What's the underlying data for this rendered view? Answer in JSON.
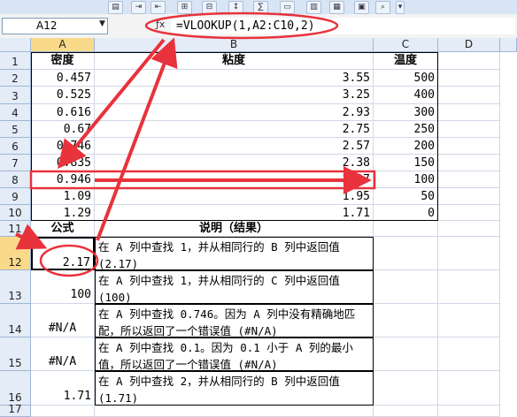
{
  "toolbar_icons": [
    "ruler-icon",
    "indent-icon",
    "outdent-icon",
    "group-icon",
    "ungroup-icon",
    "sort-icon",
    "function-icon",
    "folder-icon",
    "chart-icon",
    "chart-icon",
    "calculator-icon",
    "search-icon",
    "dropdown-icon"
  ],
  "name_box": "A12",
  "formula": "=VLOOKUP(1,A2:C10,2)",
  "columns": [
    "A",
    "B",
    "C",
    "D"
  ],
  "rows": [
    "1",
    "2",
    "3",
    "4",
    "5",
    "6",
    "7",
    "8",
    "9",
    "10",
    "11",
    "12",
    "13",
    "14",
    "15",
    "16",
    "17"
  ],
  "headers": {
    "a": "密度",
    "b": "粘度",
    "c": "温度"
  },
  "data": [
    {
      "a": "0.457",
      "b": "3.55",
      "c": "500"
    },
    {
      "a": "0.525",
      "b": "3.25",
      "c": "400"
    },
    {
      "a": "0.616",
      "b": "2.93",
      "c": "300"
    },
    {
      "a": "0.67",
      "b": "2.75",
      "c": "250"
    },
    {
      "a": "0.746",
      "b": "2.57",
      "c": "200"
    },
    {
      "a": "0.835",
      "b": "2.38",
      "c": "150"
    },
    {
      "a": "0.946",
      "b": "2.17",
      "c": "100"
    },
    {
      "a": "1.09",
      "b": "1.95",
      "c": "50"
    },
    {
      "a": "1.29",
      "b": "1.71",
      "c": "0"
    }
  ],
  "formula_header": "公式",
  "desc_header": "说明（结果）",
  "results": [
    {
      "value": "2.17",
      "desc": "在 A 列中查找 1，并从相同行的 B 列中返回值 (2.17)"
    },
    {
      "value": "100",
      "desc": "在 A 列中查找 1，并从相同行的 C 列中返回值 (100)"
    },
    {
      "value": "#N/A",
      "desc": "在 A 列中查找 0.746。因为 A 列中没有精确地匹配，所以返回了一个错误值 (#N/A)"
    },
    {
      "value": "#N/A",
      "desc": "在 A 列中查找 0.1。因为 0.1 小于 A 列的最小值，所以返回了一个错误值 (#N/A)"
    },
    {
      "value": "1.71",
      "desc": "在 A 列中查找 2，并从相同行的 B 列中返回值 (1.71)"
    }
  ],
  "colors": {
    "annotation": "#e8323c",
    "header_bg": "#e4ecf7",
    "active_header": "#f9d98a"
  }
}
